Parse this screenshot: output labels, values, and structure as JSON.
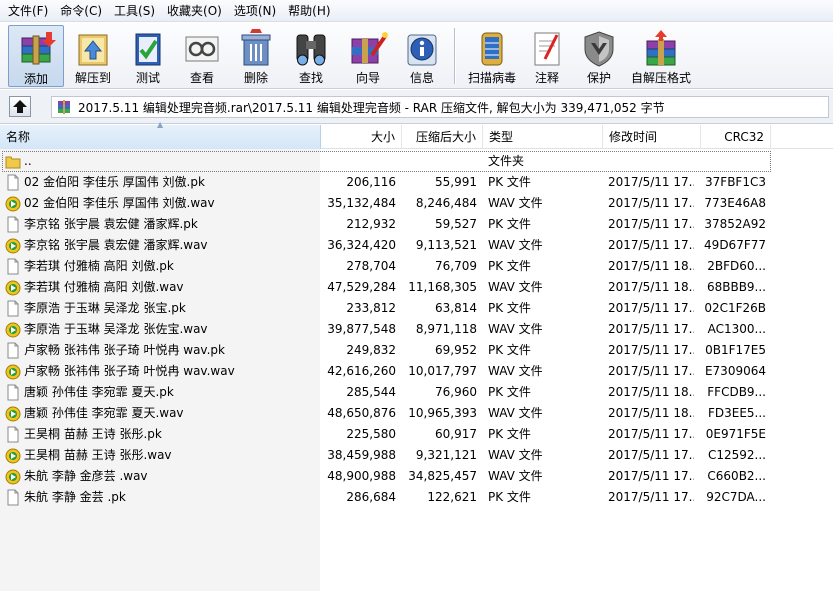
{
  "menu": [
    "文件(F)",
    "命令(C)",
    "工具(S)",
    "收藏夹(O)",
    "选项(N)",
    "帮助(H)"
  ],
  "toolbar": [
    {
      "label": "添加",
      "icon": "add-archive-icon",
      "pressed": true
    },
    {
      "label": "解压到",
      "icon": "extract-to-icon"
    },
    {
      "label": "测试",
      "icon": "test-icon"
    },
    {
      "label": "查看",
      "icon": "view-icon"
    },
    {
      "label": "删除",
      "icon": "delete-icon"
    },
    {
      "label": "查找",
      "icon": "find-icon"
    },
    {
      "label": "向导",
      "icon": "wizard-icon"
    },
    {
      "label": "信息",
      "icon": "info-icon"
    },
    {
      "label": "扫描病毒",
      "icon": "virus-scan-icon"
    },
    {
      "label": "注释",
      "icon": "comment-icon"
    },
    {
      "label": "保护",
      "icon": "protect-icon"
    },
    {
      "label": "自解压格式",
      "icon": "sfx-icon"
    }
  ],
  "address": {
    "text": "2017.5.11 编辑处理完音频.rar\\2017.5.11 编辑处理完音频 - RAR 压缩文件, 解包大小为 339,471,052 字节"
  },
  "columns": {
    "name": "名称",
    "size": "大小",
    "packed": "压缩后大小",
    "type": "类型",
    "modified": "修改时间",
    "crc": "CRC32"
  },
  "parent_row": {
    "name": "..",
    "type": "文件夹"
  },
  "files": [
    {
      "name": "02 金伯阳 李佳乐 厚国伟 刘傲.pk",
      "size": "206,116",
      "packed": "55,991",
      "type": "PK 文件",
      "modified": "2017/5/11 17...",
      "crc": "37FBF1C3",
      "kind": "pk"
    },
    {
      "name": "02 金伯阳 李佳乐 厚国伟 刘傲.wav",
      "size": "35,132,484",
      "packed": "8,246,484",
      "type": "WAV 文件",
      "modified": "2017/5/11 17...",
      "crc": "773E46A8",
      "kind": "wav"
    },
    {
      "name": "李京铭 张宇晨 袁宏健 潘家辉.pk",
      "size": "212,932",
      "packed": "59,527",
      "type": "PK 文件",
      "modified": "2017/5/11 17...",
      "crc": "37852A92",
      "kind": "pk"
    },
    {
      "name": "李京铭 张宇晨 袁宏健 潘家辉.wav",
      "size": "36,324,420",
      "packed": "9,113,521",
      "type": "WAV 文件",
      "modified": "2017/5/11 17...",
      "crc": "49D67F77",
      "kind": "wav"
    },
    {
      "name": "李若琪 付雅楠 高阳 刘傲.pk",
      "size": "278,704",
      "packed": "76,709",
      "type": "PK 文件",
      "modified": "2017/5/11 18...",
      "crc": "2BFD60...",
      "kind": "pk"
    },
    {
      "name": "李若琪 付雅楠 高阳 刘傲.wav",
      "size": "47,529,284",
      "packed": "11,168,305",
      "type": "WAV 文件",
      "modified": "2017/5/11 18...",
      "crc": "68BBB9...",
      "kind": "wav"
    },
    {
      "name": "李原浩 于玉琳 吴泽龙 张宝.pk",
      "size": "233,812",
      "packed": "63,814",
      "type": "PK 文件",
      "modified": "2017/5/11 17...",
      "crc": "02C1F26B",
      "kind": "pk"
    },
    {
      "name": "李原浩 于玉琳 吴泽龙 张佐宝.wav",
      "size": "39,877,548",
      "packed": "8,971,118",
      "type": "WAV 文件",
      "modified": "2017/5/11 17...",
      "crc": "AC1300...",
      "kind": "wav"
    },
    {
      "name": "卢家畅 张祎伟 张子琦 叶悦冉 wav.pk",
      "size": "249,832",
      "packed": "69,952",
      "type": "PK 文件",
      "modified": "2017/5/11 17...",
      "crc": "0B1F17E5",
      "kind": "pk"
    },
    {
      "name": "卢家畅 张祎伟 张子琦 叶悦冉 wav.wav",
      "size": "42,616,260",
      "packed": "10,017,797",
      "type": "WAV 文件",
      "modified": "2017/5/11 17...",
      "crc": "E7309064",
      "kind": "wav"
    },
    {
      "name": "唐颖 孙伟佳 李宛霏 夏天.pk",
      "size": "285,544",
      "packed": "76,960",
      "type": "PK 文件",
      "modified": "2017/5/11 18...",
      "crc": "FFCDB9...",
      "kind": "pk"
    },
    {
      "name": "唐颖 孙伟佳 李宛霏 夏天.wav",
      "size": "48,650,876",
      "packed": "10,965,393",
      "type": "WAV 文件",
      "modified": "2017/5/11 18...",
      "crc": "FD3EE5...",
      "kind": "wav"
    },
    {
      "name": "王昊桐 苗赫 王诗 张彤.pk",
      "size": "225,580",
      "packed": "60,917",
      "type": "PK 文件",
      "modified": "2017/5/11 17...",
      "crc": "0E971F5E",
      "kind": "pk"
    },
    {
      "name": "王昊桐 苗赫 王诗 张彤.wav",
      "size": "38,459,988",
      "packed": "9,321,121",
      "type": "WAV 文件",
      "modified": "2017/5/11 17...",
      "crc": "C12592...",
      "kind": "wav"
    },
    {
      "name": "朱航 李静 金彦芸 .wav",
      "size": "48,900,988",
      "packed": "34,825,457",
      "type": "WAV 文件",
      "modified": "2017/5/11 17...",
      "crc": "C660B2...",
      "kind": "wav"
    },
    {
      "name": "朱航 李静 金芸 .pk",
      "size": "286,684",
      "packed": "122,621",
      "type": "PK 文件",
      "modified": "2017/5/11 17...",
      "crc": "92C7DA...",
      "kind": "pk"
    }
  ]
}
